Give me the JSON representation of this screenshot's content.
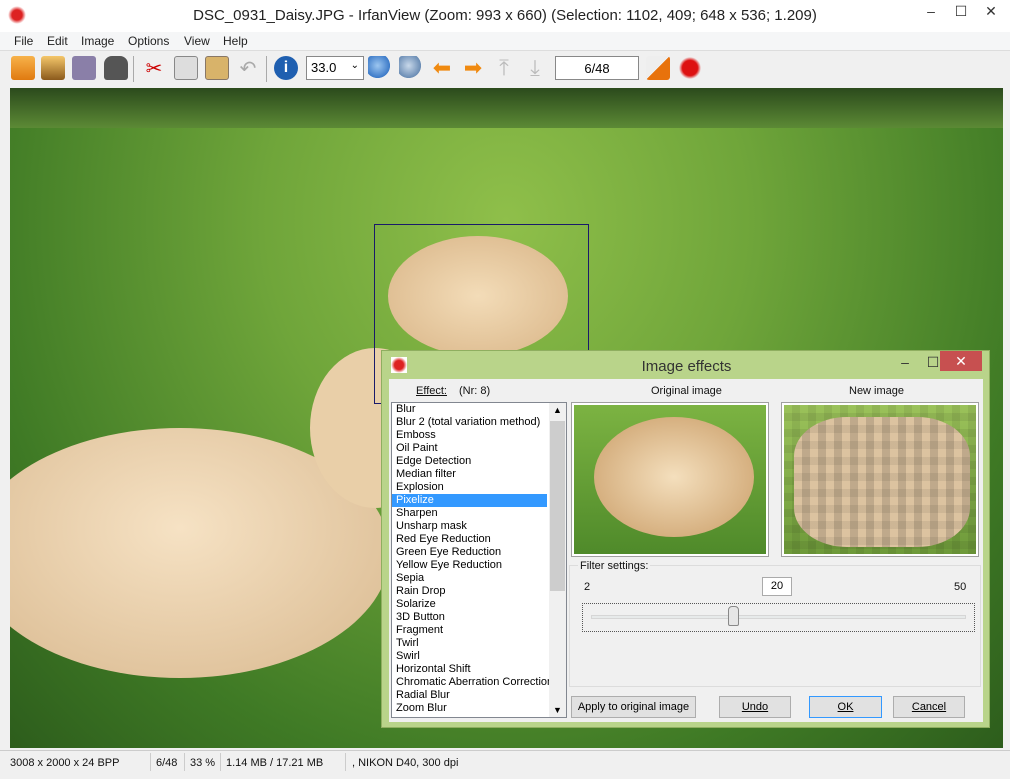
{
  "window": {
    "title": "DSC_0931_Daisy.JPG - IrfanView (Zoom: 993 x 660) (Selection: 1102, 409; 648 x 536; 1.209)",
    "minimize": "–",
    "maximize": "☐",
    "close": "✕"
  },
  "menu": [
    "File",
    "Edit",
    "Image",
    "Options",
    "View",
    "Help"
  ],
  "toolbar": {
    "icons": [
      "open-icon",
      "slideshow-icon",
      "save-icon",
      "delete-icon",
      "cut-icon",
      "copy-icon",
      "paste-icon",
      "undo-icon",
      "info-icon",
      "zoom-in-icon",
      "zoom-out-icon",
      "previous-icon",
      "next-icon",
      "first-icon",
      "last-icon",
      "settings-icon",
      "irfanview-logo-icon"
    ],
    "zoom_value": "33.0",
    "page": "6/48"
  },
  "status": {
    "dims": "3008 x 2000 x 24 BPP",
    "page": "6/48",
    "zoom": "33 %",
    "size": "1.14 MB / 17.21 MB",
    "info": ", NIKON D40, 300 dpi"
  },
  "dialog": {
    "title": "Image effects",
    "effect_label": "Effect:",
    "effect_nr": "(Nr: 8)",
    "original_label": "Original image",
    "new_label": "New image",
    "effects": [
      "Blur",
      "Blur 2 (total variation method)",
      "Emboss",
      "Oil Paint",
      "Edge Detection",
      "Median filter",
      "Explosion",
      "Pixelize",
      "Sharpen",
      "Unsharp mask",
      "Red Eye Reduction",
      "Green Eye Reduction",
      "Yellow Eye Reduction",
      "Sepia",
      "Rain Drop",
      "Solarize",
      "3D Button",
      "Fragment",
      "Twirl",
      "Swirl",
      "Horizontal Shift",
      "Chromatic Aberration Correction",
      "Radial Blur",
      "Zoom Blur"
    ],
    "selected_index": 7,
    "filter_label": "Filter settings:",
    "min": "2",
    "value": "20",
    "max": "50",
    "apply": "Apply to original image",
    "undo": "Undo",
    "ok": "OK",
    "cancel": "Cancel"
  },
  "colors": {
    "dialog_frame": "#b9d48a",
    "selection": "#3399ff",
    "close_red": "#c75050"
  }
}
